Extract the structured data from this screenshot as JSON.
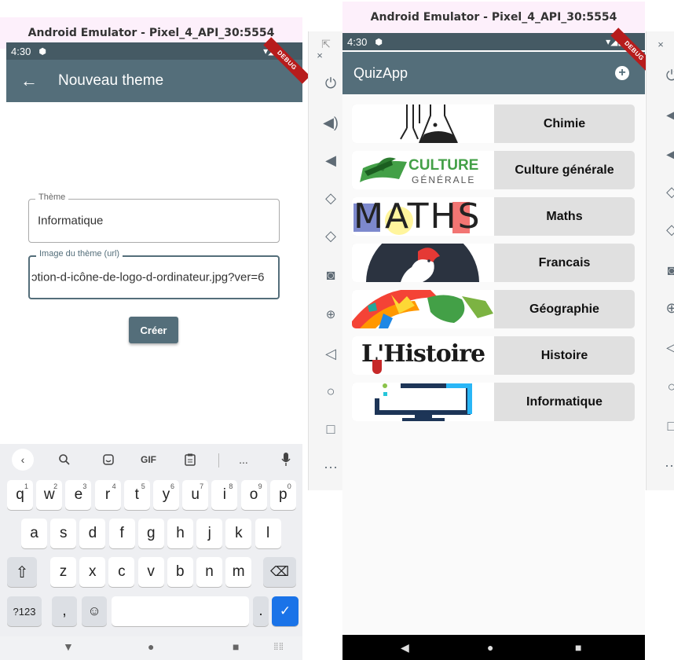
{
  "left_window": {
    "title": "Android Emulator - Pixel_4_API_30:5554",
    "status_time": "4:30",
    "debug_banner": "DEBUG",
    "appbar_title": "Nouveau theme",
    "theme_field": {
      "label": "Thème",
      "value": "Informatique"
    },
    "image_field": {
      "label": "Image du thème (url)",
      "value": "ɔtion-d-icône-de-logo-d-ordinateur.jpg?ver=6"
    },
    "create_button": "Créer",
    "keyboard": {
      "toolbar": [
        "back-icon",
        "search-icon",
        "sticker-icon",
        "GIF",
        "clipboard-icon",
        "more-icon",
        "mic-icon"
      ],
      "gif_label": "GIF",
      "more_label": "...",
      "row1": [
        {
          "k": "q",
          "n": "1"
        },
        {
          "k": "w",
          "n": "2"
        },
        {
          "k": "e",
          "n": "3"
        },
        {
          "k": "r",
          "n": "4"
        },
        {
          "k": "t",
          "n": "5"
        },
        {
          "k": "y",
          "n": "6"
        },
        {
          "k": "u",
          "n": "7"
        },
        {
          "k": "i",
          "n": "8"
        },
        {
          "k": "o",
          "n": "9"
        },
        {
          "k": "p",
          "n": "0"
        }
      ],
      "row2": [
        "a",
        "s",
        "d",
        "f",
        "g",
        "h",
        "j",
        "k",
        "l"
      ],
      "row3": [
        "z",
        "x",
        "c",
        "v",
        "b",
        "n",
        "m"
      ],
      "sym_key": "?123",
      "comma_key": ",",
      "period_key": "."
    }
  },
  "right_window": {
    "title": "Android Emulator - Pixel_4_API_30:5554",
    "status_time": "4:30",
    "debug_banner": "DEBUG",
    "appbar_title": "QuizApp",
    "themes": [
      {
        "label": "Chimie",
        "image": "chemistry-icon"
      },
      {
        "label": "Culture générale",
        "image": "culture-generale-logo",
        "logo_text_1": "CULTURE",
        "logo_text_2": "GÉNÉRALE"
      },
      {
        "label": "Maths",
        "image": "maths-logo",
        "logo_text": "MATHS"
      },
      {
        "label": "Francais",
        "image": "rooster-icon"
      },
      {
        "label": "Géographie",
        "image": "world-map-icon"
      },
      {
        "label": "Histoire",
        "image": "histoire-logo",
        "logo_text": "L'Histoire"
      },
      {
        "label": "Informatique",
        "image": "computer-icon"
      }
    ]
  },
  "colors": {
    "appbar": "#546e7a",
    "status": "#455a64",
    "card": "#e0e0e0",
    "accent_blue": "#1a73e8",
    "culture_green": "#43a047"
  },
  "side_icons": [
    "power-icon",
    "volume-up-icon",
    "volume-down-icon",
    "rotate-left-icon",
    "rotate-right-icon",
    "camera-icon",
    "zoom-icon",
    "back-triangle-icon",
    "home-circle-icon",
    "overview-square-icon",
    "more-icon"
  ]
}
